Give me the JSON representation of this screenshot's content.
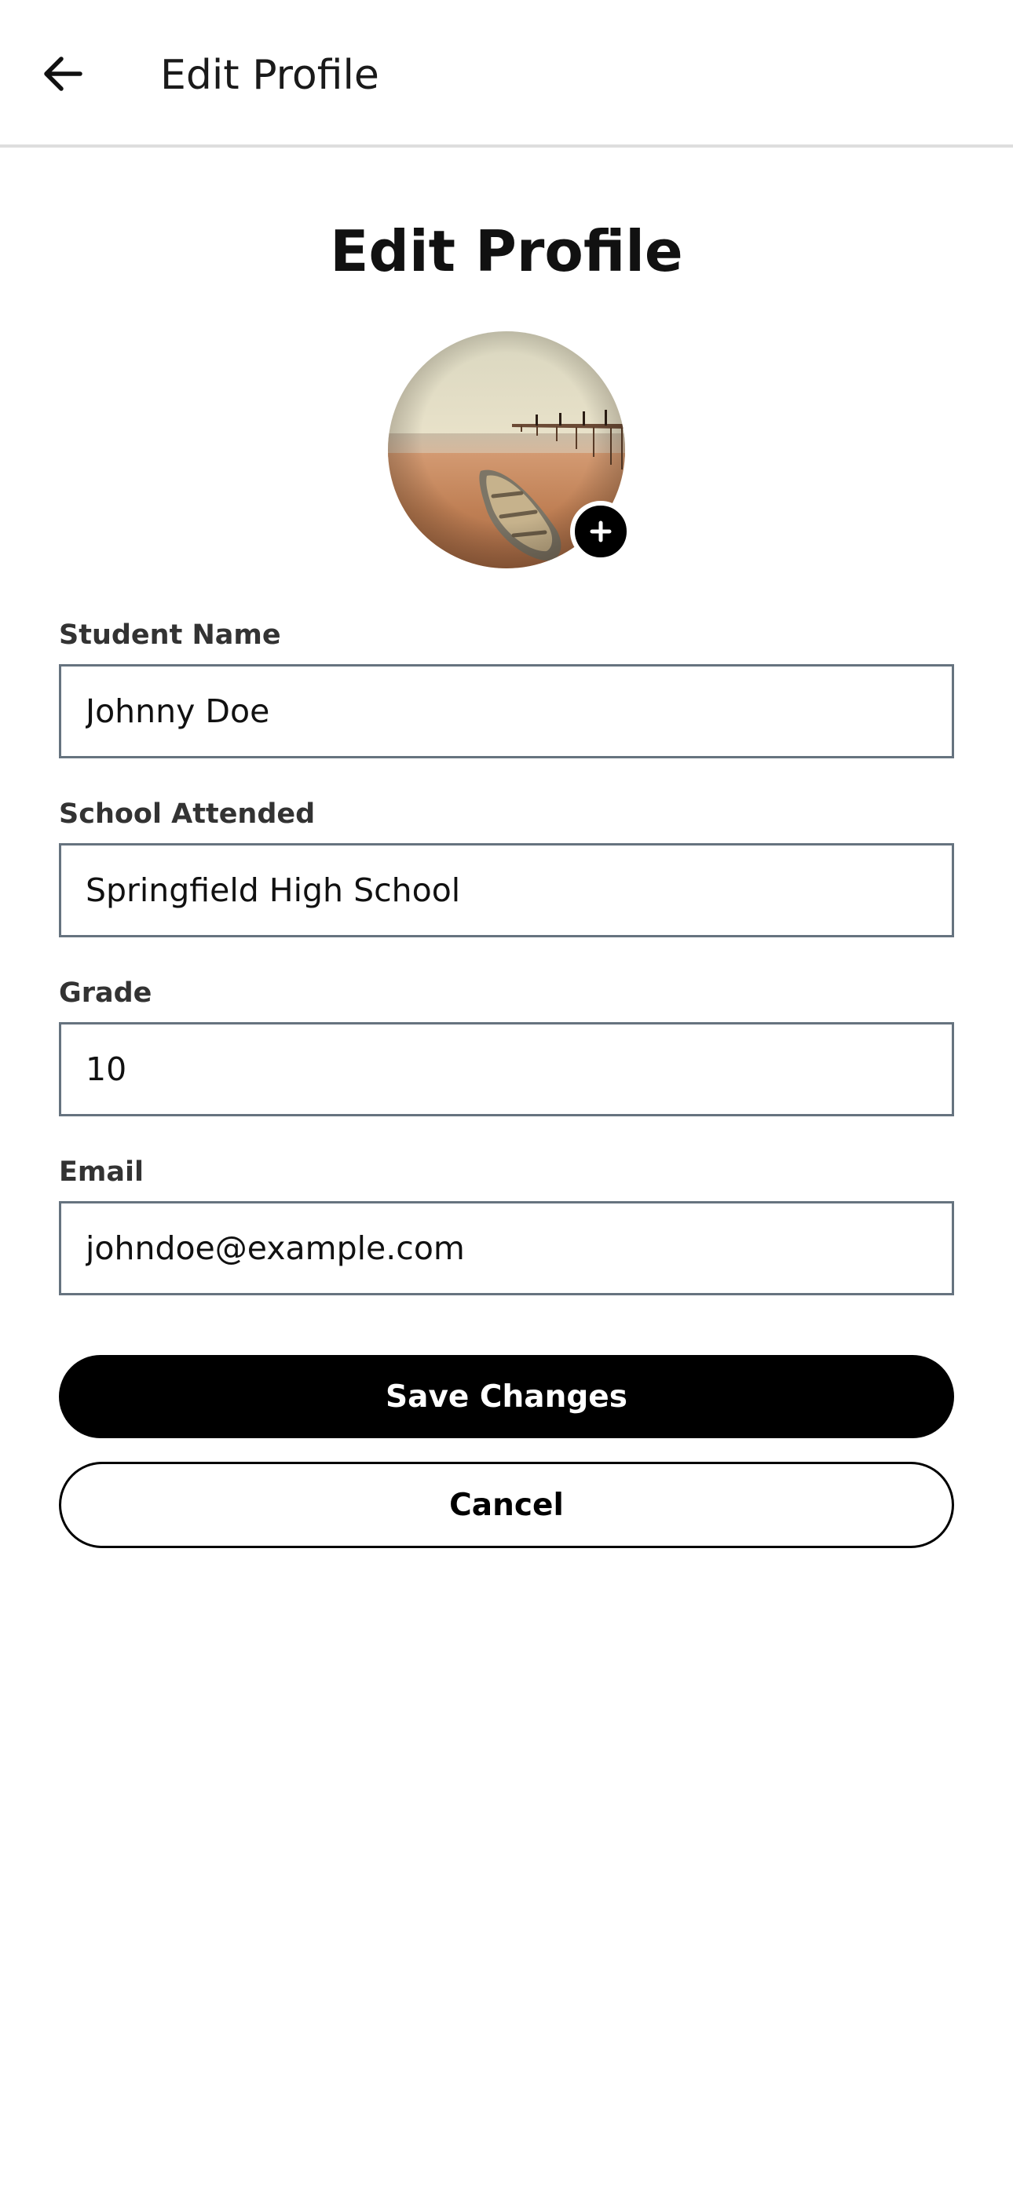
{
  "app_bar": {
    "title": "Edit Profile"
  },
  "page": {
    "title": "Edit Profile"
  },
  "avatar": {
    "icon": "plus-icon"
  },
  "form": {
    "student_name": {
      "label": "Student Name",
      "value": "Johnny Doe"
    },
    "school": {
      "label": "School Attended",
      "value": "Springfield High School"
    },
    "grade": {
      "label": "Grade",
      "value": "10"
    },
    "email": {
      "label": "Email",
      "value": "johndoe@example.com"
    }
  },
  "actions": {
    "save_label": "Save Changes",
    "cancel_label": "Cancel"
  },
  "colors": {
    "primary": "#000000",
    "input_border": "#66737f",
    "divider": "#dedede",
    "label_text": "#333333"
  }
}
